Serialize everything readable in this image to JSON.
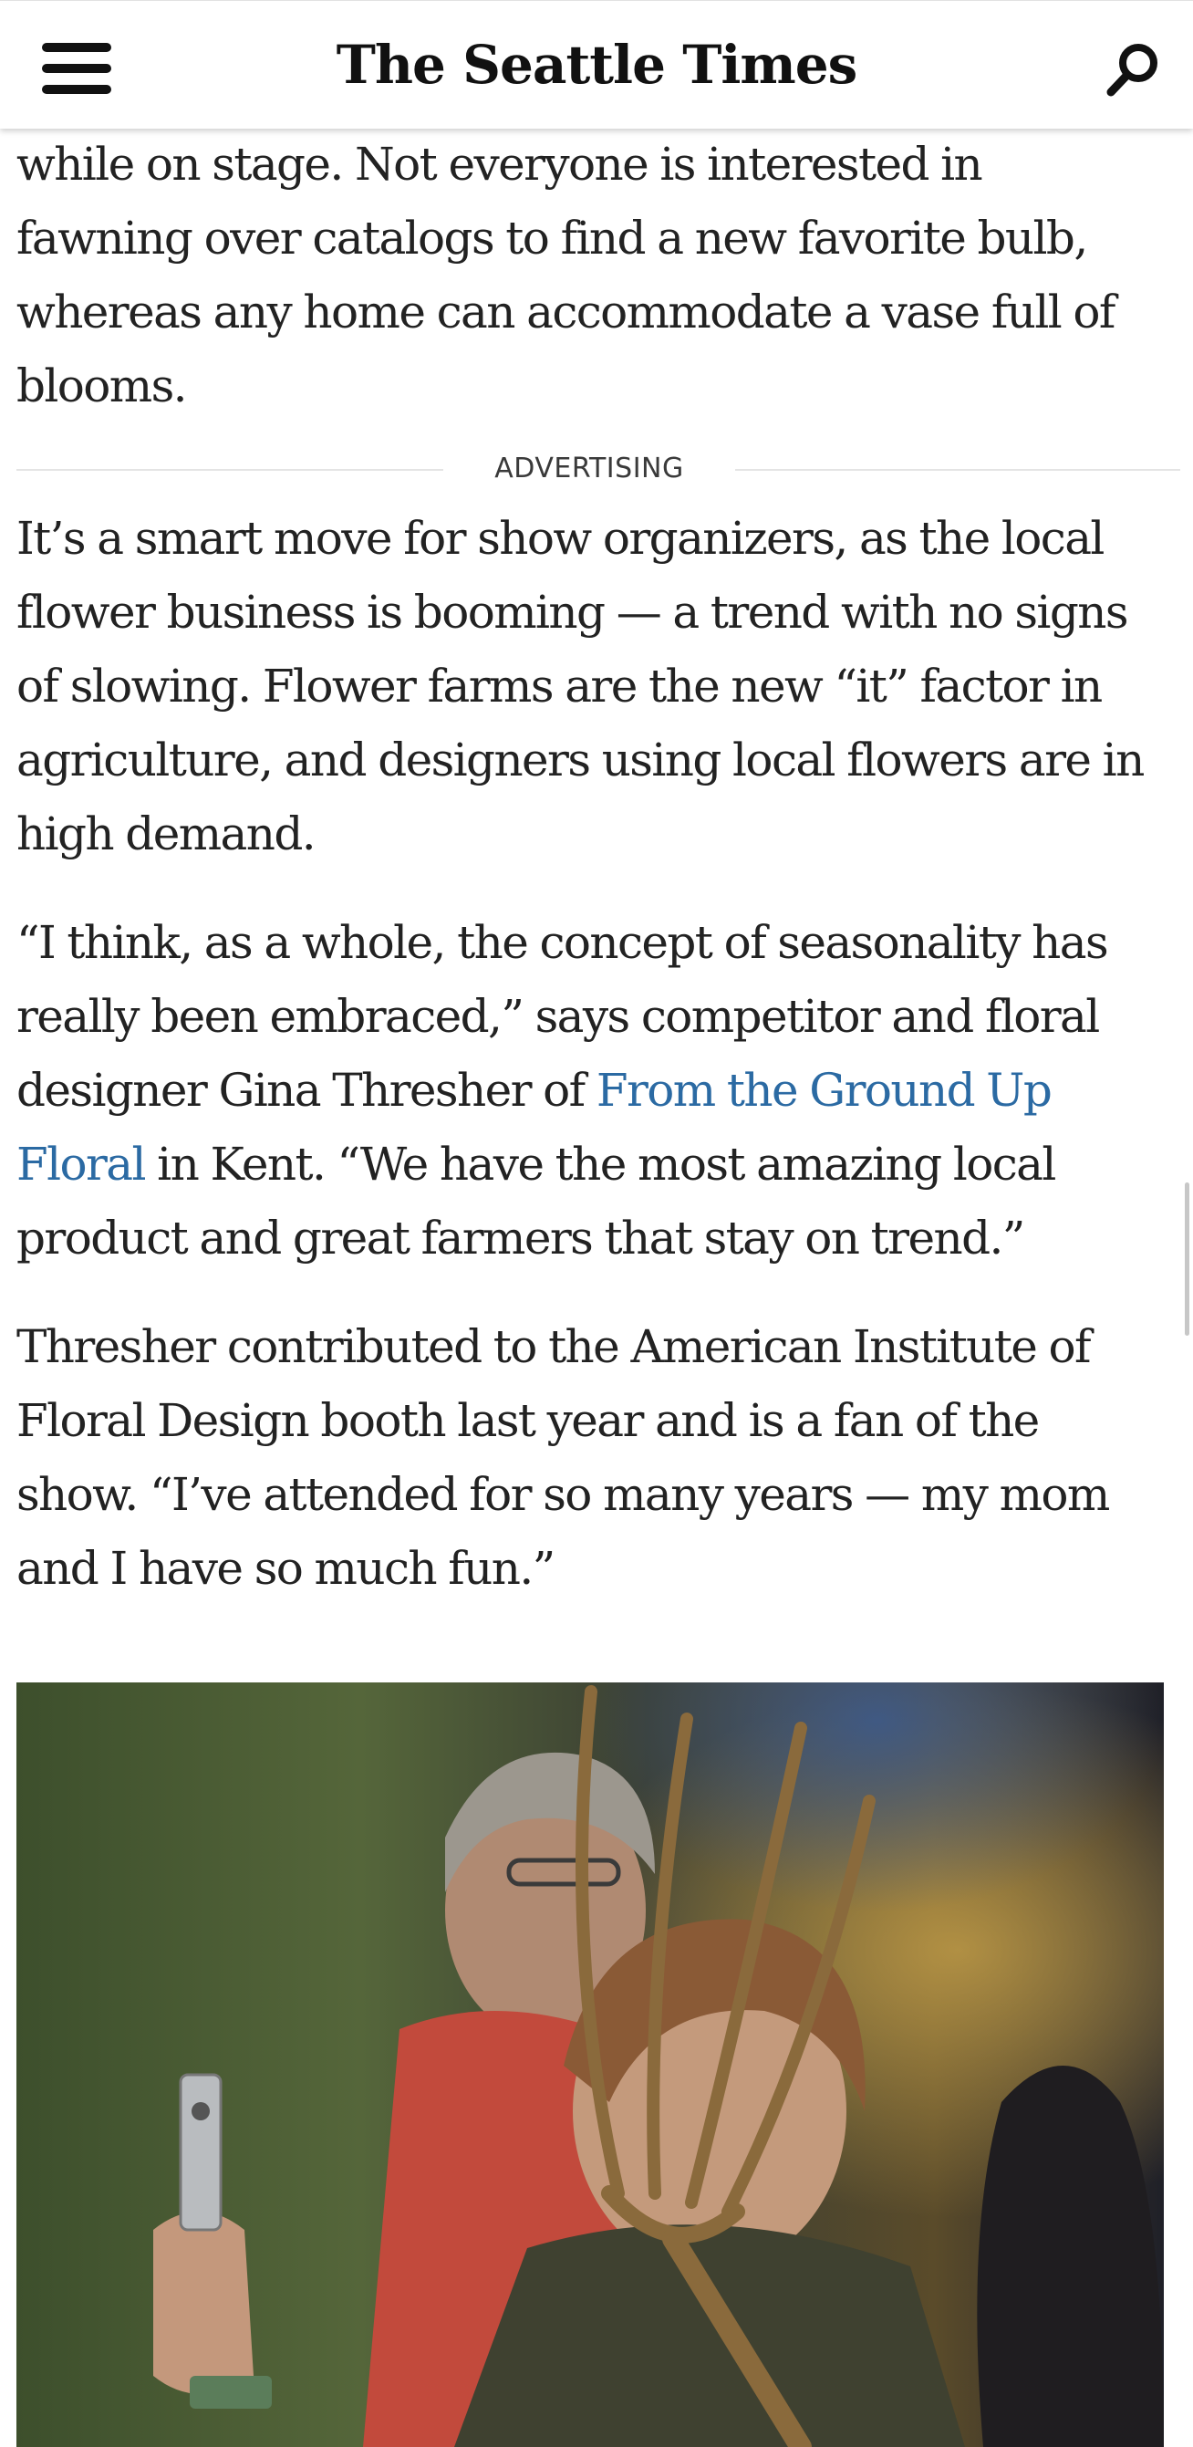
{
  "header": {
    "logo_text": "The Seattle Times"
  },
  "icons": {
    "menu": "hamburger-menu-icon",
    "search": "search-icon"
  },
  "article": {
    "para_intro": "while on stage. Not everyone is interested in fawning over catalogs to find a new favorite bulb, whereas any home can accommodate a vase full of blooms.",
    "advertising_label": "ADVERTISING",
    "para_organizers": "It’s a smart move for show organizers, as the local flower business is booming — a trend with no signs of slowing. Flower farms are the new “it” factor in agriculture, and designers using local flowers are in high demand.",
    "para_quote_start": "“I think, as a whole, the concept of seasonality has really been embraced,” says competitor and floral designer Gina Thresher of ",
    "para_quote_link": "From the Ground Up Floral",
    "para_quote_end": " in Kent. “We have the most amazing local product and great farmers that stay on trend.”",
    "para_thresher": "Thresher contributed to the American Institute of Floral Design booth last year and is a fan of the show. “I’ve attended for so many years — my mom and I have so much fun.”"
  },
  "colors": {
    "link": "#2b6aa3",
    "text": "#222222",
    "divider": "#e4e4e4"
  }
}
